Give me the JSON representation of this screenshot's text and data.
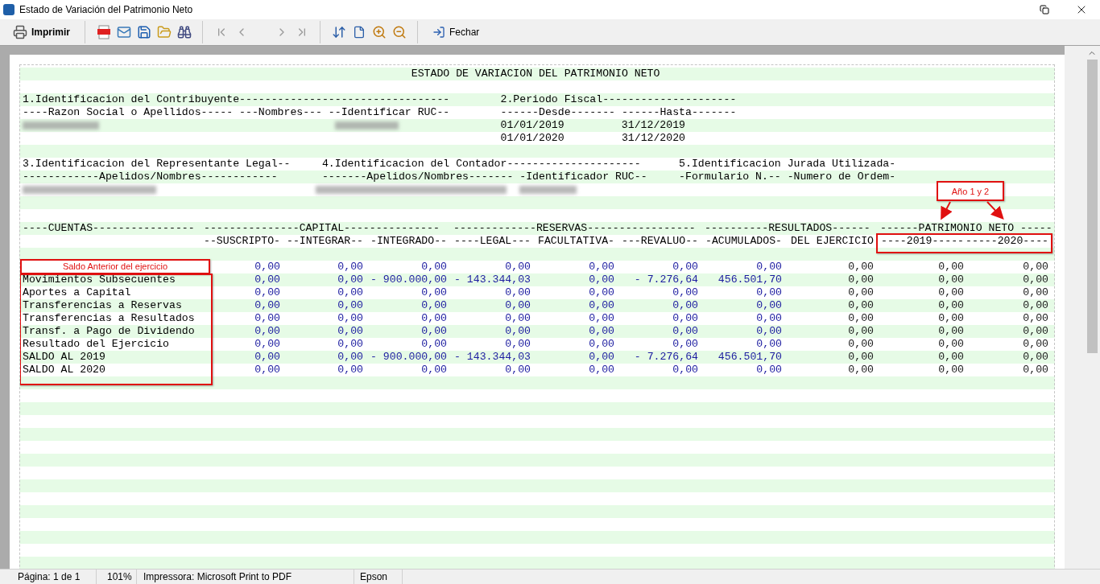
{
  "window": {
    "title": "Estado de Variación del Patrimonio Neto"
  },
  "toolbar": {
    "print_label": "Imprimir",
    "close_label": "Fechar",
    "navigation_disabled": true
  },
  "report": {
    "title": "ESTADO DE VARIACION DEL PATRIMONIO NETO",
    "contribuyente": {
      "heading": "1.Identificacion del Contribuyente---------------------------------",
      "subheading": "----Razon Social o Apellidos----- ---Nombres--- --Identificar RUC--"
    },
    "periodo": {
      "heading": "2.Periodo Fiscal---------------------",
      "subheading": "------Desde------- ------Hasta-------",
      "rows": [
        {
          "desde": "01/01/2019",
          "hasta": "31/12/2019"
        },
        {
          "desde": "01/01/2020",
          "hasta": "31/12/2020"
        }
      ]
    },
    "representante": {
      "heading": "3.Identificacion del Representante Legal--",
      "subheading": "------------Apelidos/Nombres------------"
    },
    "contador": {
      "heading": "4.Identificacion del Contador---------------------",
      "subheading": "-------Apelidos/Nombres------- -Identificador RUC--"
    },
    "jurada": {
      "heading": "5.Identificacion Jurada Utilizada-",
      "subheading": "-Formulario N.-- -Numero de Ordem-"
    }
  },
  "table": {
    "groups": [
      "----CUENTAS----------------",
      "---------------CAPITAL---------------",
      "-------------RESERVAS-----------------",
      "----------RESULTADOS------",
      "------PATRIMONIO NETO -----"
    ],
    "columns": [
      {
        "header": "--SUSCRIPTO-",
        "color": "#1c1ca0"
      },
      {
        "header": "--INTEGRAR--",
        "color": "#1c1ca0"
      },
      {
        "header": "-INTEGRADO--",
        "color": "#1c1ca0"
      },
      {
        "header": "----LEGAL---",
        "color": "#1c1ca0"
      },
      {
        "header": "FACULTATIVA-",
        "color": "#1c1ca0"
      },
      {
        "header": "---REVALUO--",
        "color": "#1c1ca0"
      },
      {
        "header": "-ACUMULADOS-",
        "color": "#1c1ca0"
      },
      {
        "header": "DEL EJERCICIO",
        "color": "#202020"
      },
      {
        "header": "----2019-----",
        "color": "#202020"
      },
      {
        "header": "-----2020----",
        "color": "#202020"
      }
    ],
    "rows": [
      {
        "label": "Saldo Anterior del ejercicio",
        "callout": true,
        "values": [
          "0,00",
          "0,00",
          "0,00",
          "0,00",
          "0,00",
          "0,00",
          "0,00",
          "0,00",
          "0,00",
          "0,00"
        ]
      },
      {
        "label": "Movimientos Subsecuentes",
        "callout": false,
        "values": [
          "0,00",
          "0,00",
          "- 900.000,00",
          "- 143.344,03",
          "0,00",
          "- 7.276,64",
          "456.501,70",
          "0,00",
          "0,00",
          "0,00"
        ]
      },
      {
        "label": "Aportes a Capital",
        "callout": false,
        "values": [
          "0,00",
          "0,00",
          "0,00",
          "0,00",
          "0,00",
          "0,00",
          "0,00",
          "0,00",
          "0,00",
          "0,00"
        ]
      },
      {
        "label": "Transferencias a Reservas",
        "callout": false,
        "values": [
          "0,00",
          "0,00",
          "0,00",
          "0,00",
          "0,00",
          "0,00",
          "0,00",
          "0,00",
          "0,00",
          "0,00"
        ]
      },
      {
        "label": "Transferencias a Resultados",
        "callout": false,
        "values": [
          "0,00",
          "0,00",
          "0,00",
          "0,00",
          "0,00",
          "0,00",
          "0,00",
          "0,00",
          "0,00",
          "0,00"
        ]
      },
      {
        "label": "Transf. a Pago de Dividendo",
        "callout": false,
        "values": [
          "0,00",
          "0,00",
          "0,00",
          "0,00",
          "0,00",
          "0,00",
          "0,00",
          "0,00",
          "0,00",
          "0,00"
        ]
      },
      {
        "label": "Resultado del Ejercicio",
        "callout": false,
        "values": [
          "0,00",
          "0,00",
          "0,00",
          "0,00",
          "0,00",
          "0,00",
          "0,00",
          "0,00",
          "0,00",
          "0,00"
        ]
      },
      {
        "label": "SALDO AL 2019",
        "callout": false,
        "values": [
          "0,00",
          "0,00",
          "- 900.000,00",
          "- 143.344,03",
          "0,00",
          "- 7.276,64",
          "456.501,70",
          "0,00",
          "0,00",
          "0,00"
        ]
      },
      {
        "label": "SALDO AL 2020",
        "callout": false,
        "values": [
          "0,00",
          "0,00",
          "0,00",
          "0,00",
          "0,00",
          "0,00",
          "0,00",
          "0,00",
          "0,00",
          "0,00"
        ]
      }
    ]
  },
  "annotations": {
    "year_callout": "Año 1 y 2"
  },
  "status_bar": [
    "Página: 1 de 1",
    "101%",
    "Impressora: Microsoft Print to PDF",
    "Epson"
  ]
}
